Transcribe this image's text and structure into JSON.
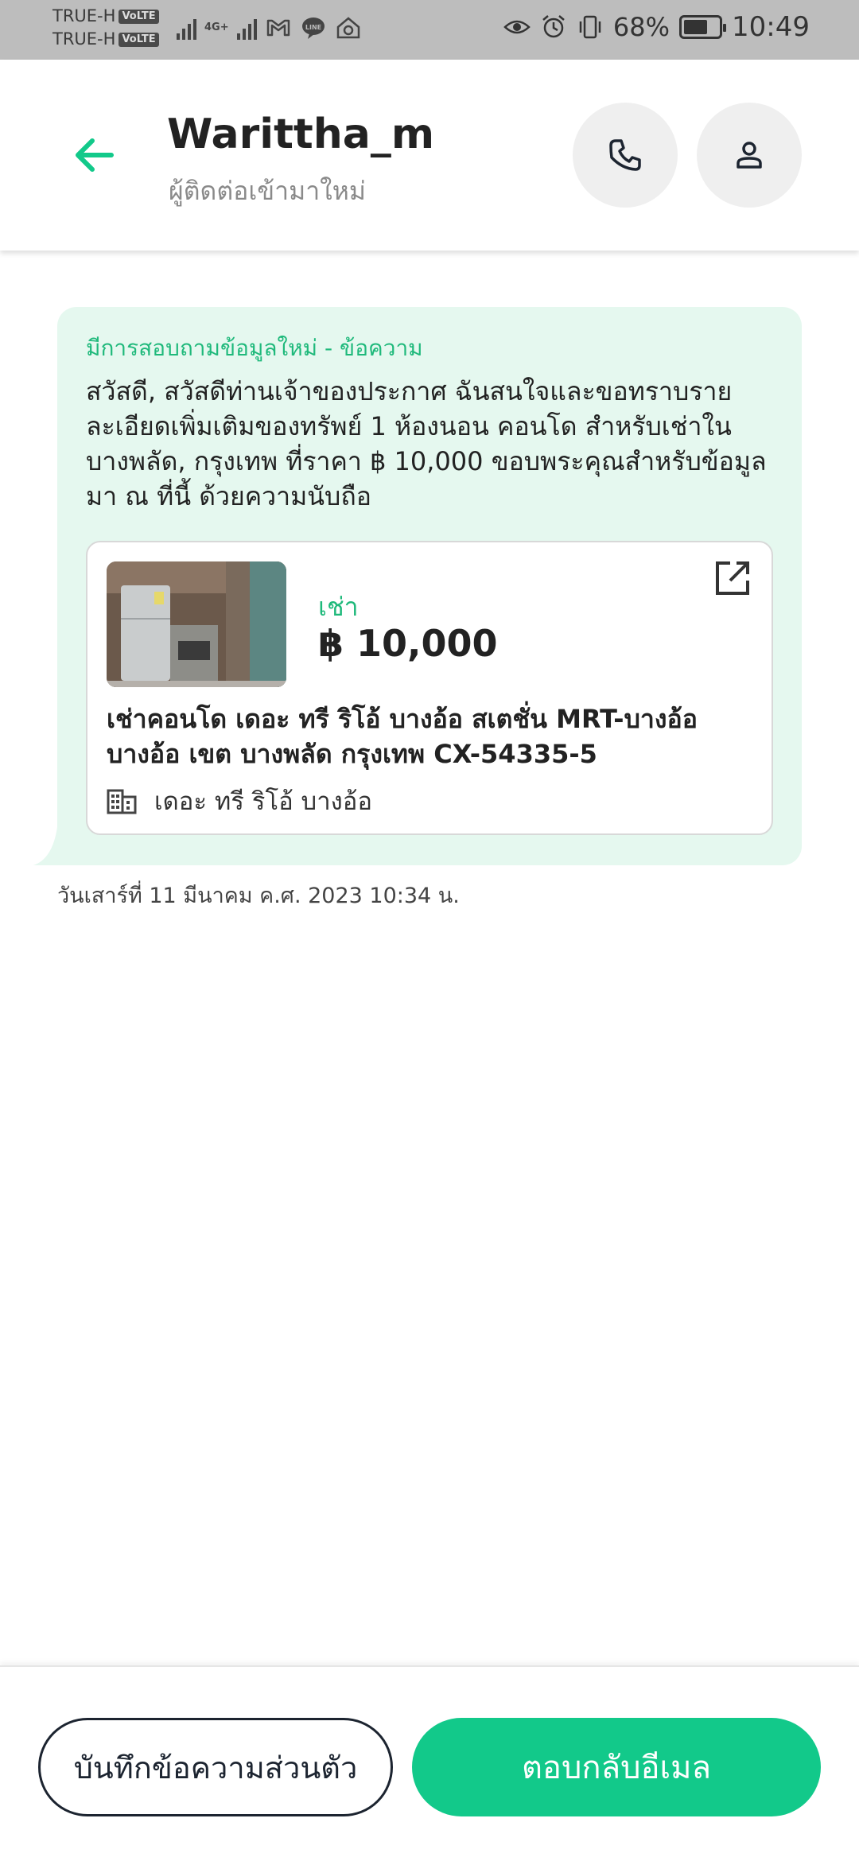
{
  "status_bar": {
    "carrier_1": "TRUE-H",
    "carrier_2": "TRUE-H",
    "volte_badge": "VoLTE",
    "network_label": "4G+",
    "battery_percent": "68%",
    "battery_level": 0.68,
    "time": "10:49"
  },
  "header": {
    "title": "Warittha_m",
    "subtitle": "ผู้ติดต่อเข้ามาใหม่",
    "back_icon": "arrow-left-icon",
    "call_icon": "phone-icon",
    "profile_icon": "person-icon"
  },
  "message": {
    "label": "มีการสอบถามข้อมูลใหม่ - ข้อความ",
    "body": "สวัสดี, สวัสดีท่านเจ้าของประกาศ ฉันสนใจและขอทราบรายละเอียดเพิ่มเติมของทรัพย์ 1 ห้องนอน คอนโด สำหรับเช่าใน บางพลัด, กรุงเทพ ที่ราคา ฿ 10,000 ขอบพระคุณสำหรับข้อมูลมา ณ ที่นี้ ด้วยความนับถือ",
    "timestamp": "วันเสาร์ที่ 11 มีนาคม ค.ศ. 2023 10:34 น."
  },
  "listing": {
    "type": "เช่า",
    "price": "฿ 10,000",
    "title": "เช่าคอนโด  เดอะ ทรี ริโอ้ บางอ้อ สเตชั่น MRT-บางอ้อ บางอ้อ เขต บางพลัด กรุงเทพ CX-54335-5",
    "building": "เดอะ ทรี ริโอ้ บางอ้อ",
    "open_icon": "open-external-icon",
    "building_icon": "building-icon"
  },
  "actions": {
    "note_label": "บันทึกข้อความส่วนตัว",
    "reply_label": "ตอบกลับอีเมล"
  },
  "colors": {
    "accent": "#12c98a",
    "bubble_bg": "#e5f8ef",
    "label_green": "#1fb97b",
    "status_bar": "#bdbdbd"
  }
}
